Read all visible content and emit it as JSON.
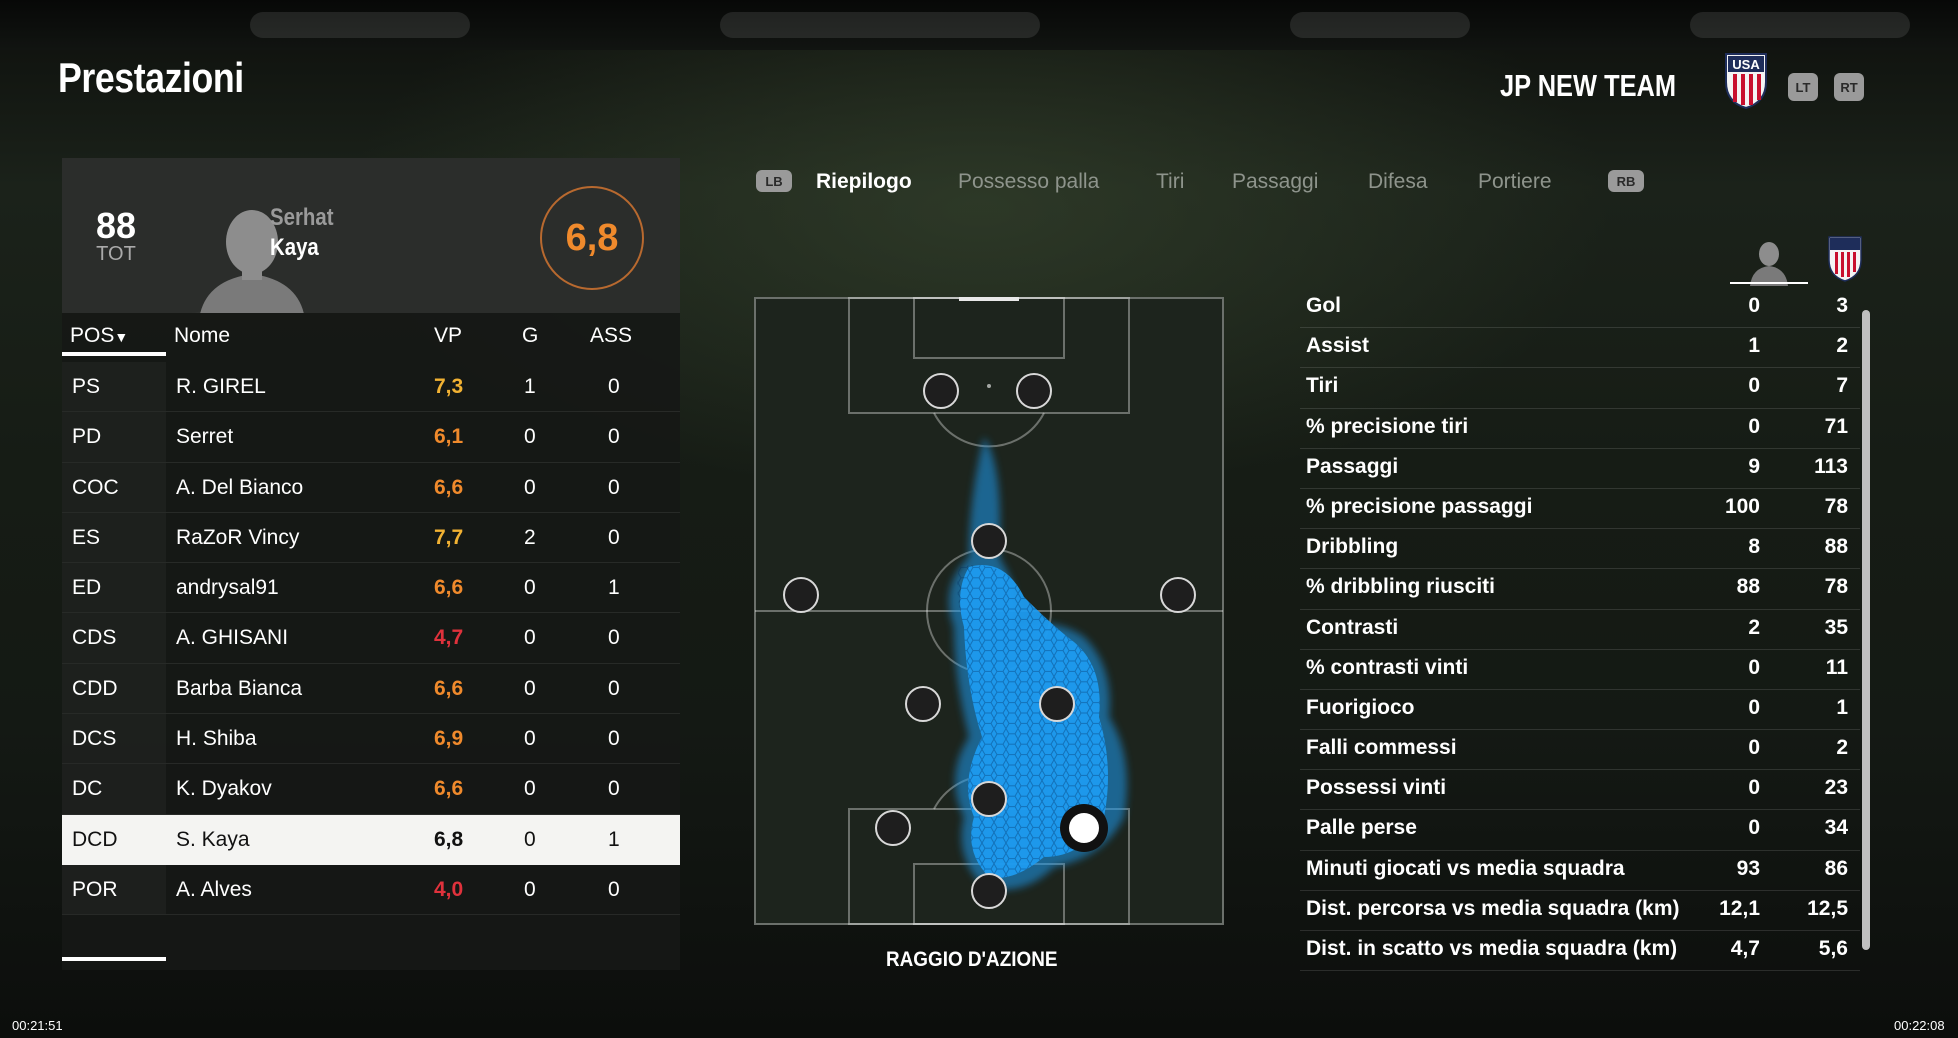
{
  "page": {
    "title": "Prestazioni"
  },
  "team": {
    "name": "JP NEW TEAM",
    "crest_label": "USA",
    "prev_btn": "LT",
    "next_btn": "RT"
  },
  "player_card": {
    "overall": "88",
    "overall_label": "TOT",
    "first_name": "Serhat",
    "last_name": "Kaya",
    "rating": "6,8"
  },
  "table": {
    "headers": {
      "pos": "POS",
      "name": "Nome",
      "vp": "VP",
      "g": "G",
      "ass": "ASS"
    },
    "rows": [
      {
        "pos": "PS",
        "name": "R. GIREL",
        "vp": "7,3",
        "g": "1",
        "ass": "0",
        "vp_color": "#f2b233"
      },
      {
        "pos": "PD",
        "name": "Serret",
        "vp": "6,1",
        "g": "0",
        "ass": "0",
        "vp_color": "#f08a2c"
      },
      {
        "pos": "COC",
        "name": "A. Del Bianco",
        "vp": "6,6",
        "g": "0",
        "ass": "0",
        "vp_color": "#f08a2c"
      },
      {
        "pos": "ES",
        "name": "RaZoR Vincy",
        "vp": "7,7",
        "g": "2",
        "ass": "0",
        "vp_color": "#f2b233"
      },
      {
        "pos": "ED",
        "name": "andrysal91",
        "vp": "6,6",
        "g": "0",
        "ass": "1",
        "vp_color": "#f08a2c"
      },
      {
        "pos": "CDS",
        "name": "A. GHISANI",
        "vp": "4,7",
        "g": "0",
        "ass": "0",
        "vp_color": "#e0323c"
      },
      {
        "pos": "CDD",
        "name": "Barba Bianca",
        "vp": "6,6",
        "g": "0",
        "ass": "0",
        "vp_color": "#f08a2c"
      },
      {
        "pos": "DCS",
        "name": "H. Shiba",
        "vp": "6,9",
        "g": "0",
        "ass": "0",
        "vp_color": "#f08a2c"
      },
      {
        "pos": "DC",
        "name": "K. Dyakov",
        "vp": "6,6",
        "g": "0",
        "ass": "0",
        "vp_color": "#f08a2c"
      },
      {
        "pos": "DCD",
        "name": "S. Kaya",
        "vp": "6,8",
        "g": "0",
        "ass": "1",
        "vp_color": "#111111",
        "selected": true
      },
      {
        "pos": "POR",
        "name": "A. Alves",
        "vp": "4,0",
        "g": "0",
        "ass": "0",
        "vp_color": "#e0323c"
      }
    ]
  },
  "tabs": {
    "left_btn": "LB",
    "right_btn": "RB",
    "items": [
      "Riepilogo",
      "Possesso palla",
      "Tiri",
      "Passaggi",
      "Difesa",
      "Portiere"
    ],
    "active": "Riepilogo"
  },
  "heatmap": {
    "caption": "RAGGIO D'AZIONE"
  },
  "stats": [
    {
      "label": "Gol",
      "player": "0",
      "team": "3"
    },
    {
      "label": "Assist",
      "player": "1",
      "team": "2"
    },
    {
      "label": "Tiri",
      "player": "0",
      "team": "7"
    },
    {
      "label": "% precisione tiri",
      "player": "0",
      "team": "71"
    },
    {
      "label": "Passaggi",
      "player": "9",
      "team": "113"
    },
    {
      "label": "% precisione passaggi",
      "player": "100",
      "team": "78"
    },
    {
      "label": "Dribbling",
      "player": "8",
      "team": "88"
    },
    {
      "label": "% dribbling riusciti",
      "player": "88",
      "team": "78"
    },
    {
      "label": "Contrasti",
      "player": "2",
      "team": "35"
    },
    {
      "label": "% contrasti vinti",
      "player": "0",
      "team": "11"
    },
    {
      "label": "Fuorigioco",
      "player": "0",
      "team": "1"
    },
    {
      "label": "Falli commessi",
      "player": "0",
      "team": "2"
    },
    {
      "label": "Possessi vinti",
      "player": "0",
      "team": "23"
    },
    {
      "label": "Palle perse",
      "player": "0",
      "team": "34"
    },
    {
      "label": "Minuti giocati vs media squadra",
      "player": "93",
      "team": "86"
    },
    {
      "label": "Dist. percorsa vs media squadra (km)",
      "player": "12,1",
      "team": "12,5"
    },
    {
      "label": "Dist. in scatto vs media squadra (km)",
      "player": "4,7",
      "team": "5,6"
    }
  ],
  "timestamps": {
    "left": "00:21:51",
    "right": "00:22:08"
  },
  "colors": {
    "accent_orange": "#f08a2c",
    "heat_blue": "#1e9bf0",
    "red": "#e0323c"
  }
}
